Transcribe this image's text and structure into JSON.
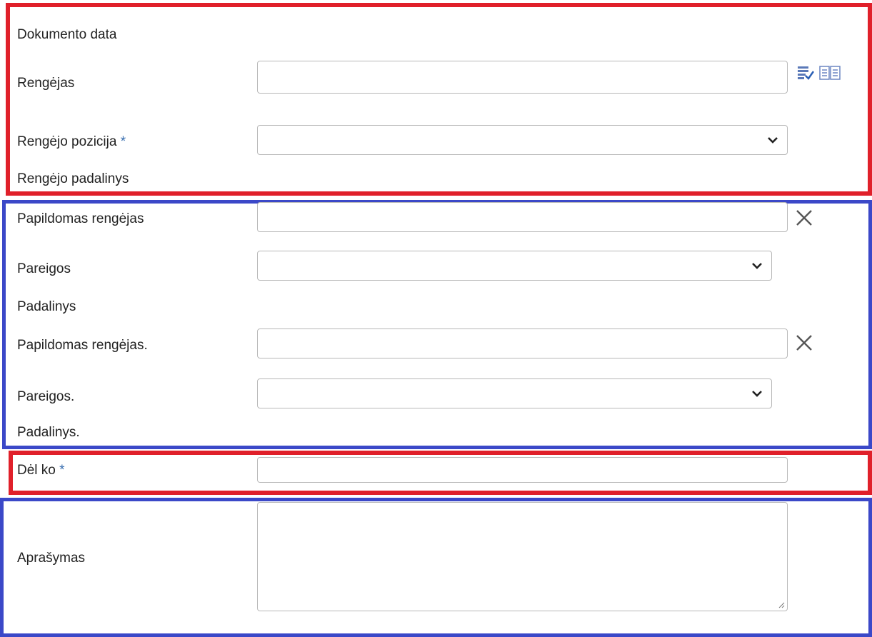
{
  "section_top": {
    "document_date_label": "Dokumento data",
    "author_label": "Rengėjas",
    "author_value": "",
    "author_position_label": "Rengėjo pozicija",
    "author_position_value": "",
    "author_division_label": "Rengėjo padalinys",
    "required_mark": "*"
  },
  "additional_authors": [
    {
      "author_label": "Papildomas rengėjas",
      "author_value": "",
      "duties_label": "Pareigos",
      "duties_value": "",
      "division_label": "Padalinys"
    },
    {
      "author_label": "Papildomas rengėjas.",
      "author_value": "",
      "duties_label": "Pareigos.",
      "duties_value": "",
      "division_label": "Padalinys."
    }
  ],
  "reason": {
    "label": "Dėl ko",
    "required_mark": "*",
    "value": ""
  },
  "description": {
    "label": "Aprašymas",
    "value": ""
  },
  "icons": {
    "list_check": "list-check-icon",
    "book": "book-icon",
    "remove": "close-icon",
    "dropdown": "chevron-down-icon"
  },
  "colors": {
    "highlight_red": "#e0202a",
    "highlight_blue": "#3b48c8",
    "required_asterisk": "#3a6fb0"
  }
}
